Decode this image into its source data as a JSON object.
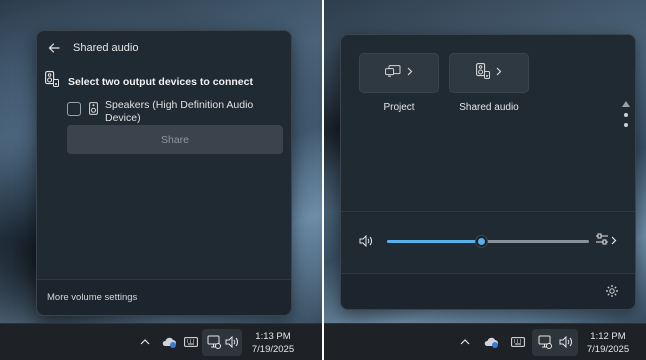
{
  "left_panel": {
    "flyout": {
      "title": "Shared audio",
      "section_title": "Select two output devices to connect",
      "devices": [
        {
          "label": "Speakers (High Definition Audio Device)",
          "checked": false
        }
      ],
      "share_button": {
        "label": "Share",
        "enabled": false
      },
      "footer_link": "More volume settings"
    },
    "taskbar": {
      "time": "1:13 PM",
      "date": "7/19/2025"
    }
  },
  "right_panel": {
    "quick_settings": {
      "tiles": [
        {
          "label": "Project",
          "icon": "project-icon"
        },
        {
          "label": "Shared audio",
          "icon": "shared-audio-icon"
        }
      ],
      "volume": {
        "level_percent": 47,
        "icon": "speaker-icon"
      }
    },
    "taskbar": {
      "time": "1:12 PM",
      "date": "7/19/2025"
    }
  },
  "colors": {
    "accent": "#58b1e8",
    "flyout_bg": "#202a33",
    "taskbar_bg": "#1e2226"
  }
}
